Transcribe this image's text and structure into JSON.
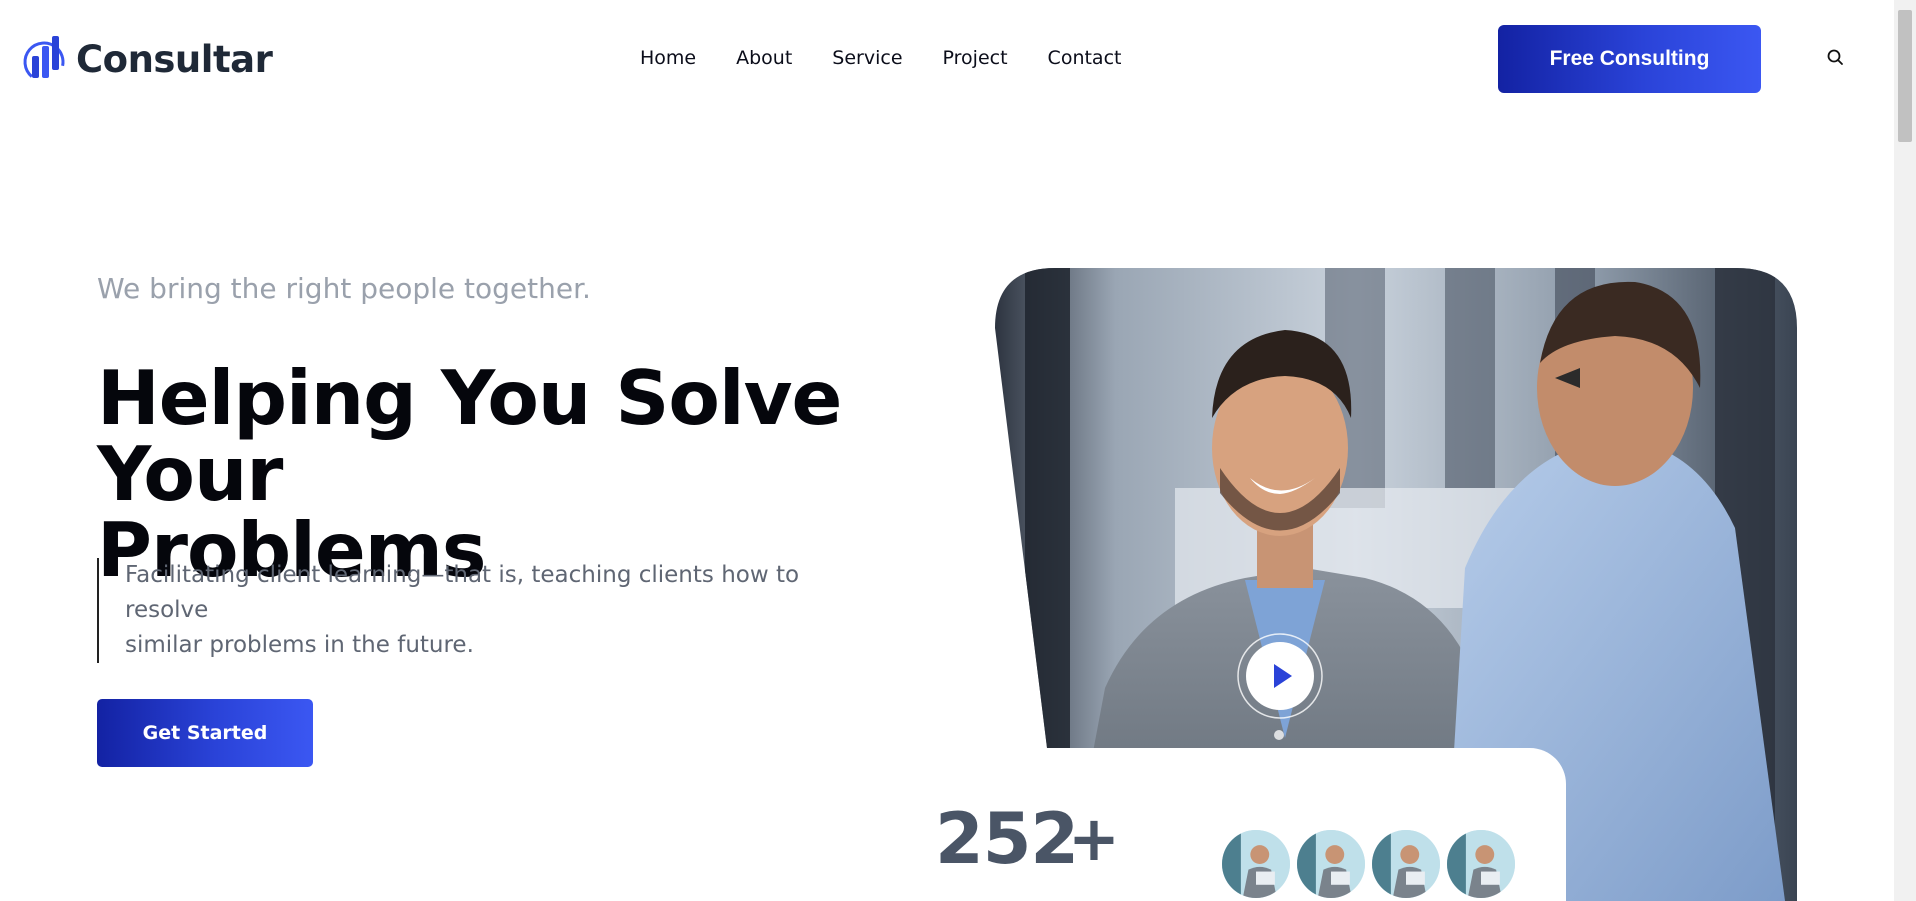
{
  "brand": {
    "name": "Consultar",
    "accent": "#2a43d8",
    "accent_dark": "#1322a3"
  },
  "nav": {
    "items": [
      {
        "label": "Home"
      },
      {
        "label": "About"
      },
      {
        "label": "Service"
      },
      {
        "label": "Project"
      },
      {
        "label": "Contact"
      }
    ],
    "cta_label": "Free Consulting",
    "search_icon": "search-icon"
  },
  "hero": {
    "eyebrow": "We bring the right people together.",
    "headline_line1": "Helping You Solve Your",
    "headline_line2": "Problems",
    "quote_line1": "Facilitating client learning—that is, teaching clients how to resolve",
    "quote_line2": "similar problems in the future.",
    "button_label": "Get Started",
    "play_icon": "play-icon"
  },
  "stats": {
    "number": "252",
    "suffix": "+"
  }
}
